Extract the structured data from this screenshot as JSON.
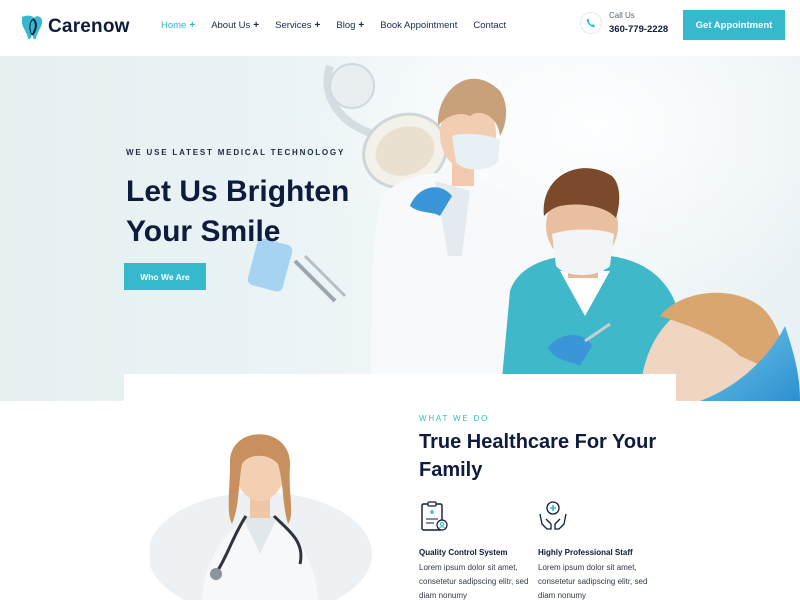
{
  "brand": {
    "name": "Carenow"
  },
  "nav": {
    "items": [
      {
        "label": "Home",
        "has_submenu": true,
        "active": true
      },
      {
        "label": "About Us",
        "has_submenu": true,
        "active": false
      },
      {
        "label": "Services",
        "has_submenu": true,
        "active": false
      },
      {
        "label": "Blog",
        "has_submenu": true,
        "active": false
      },
      {
        "label": "Book Appointment",
        "has_submenu": false,
        "active": false
      },
      {
        "label": "Contact",
        "has_submenu": false,
        "active": false
      }
    ],
    "submenu_symbol": "+"
  },
  "call": {
    "label": "Call Us",
    "number": "360-779-2228",
    "icon": "phone-icon"
  },
  "header_cta": {
    "label": "Get Appointment"
  },
  "hero": {
    "eyebrow": "WE USE LATEST MEDICAL TECHNOLOGY",
    "title": "Let Us Brighten Your Smile",
    "button": "Who We Are"
  },
  "section": {
    "eyebrow": "WHAT WE DO",
    "title": "True Healthcare For Your Family",
    "features": [
      {
        "icon": "clipboard-medical-icon",
        "title": "Quality Control System",
        "text": "Lorem ipsum dolor sit amet, consetetur sadipscing elitr, sed diam nonumy"
      },
      {
        "icon": "care-hands-icon",
        "title": "Highly Professional Staff",
        "text": "Lorem ipsum dolor sit amet, consetetur sadipscing elitr, sed diam nonumy"
      }
    ]
  },
  "colors": {
    "accent": "#36b9cd",
    "navy": "#0e1b3d",
    "scrub": "#3fb8c9"
  }
}
